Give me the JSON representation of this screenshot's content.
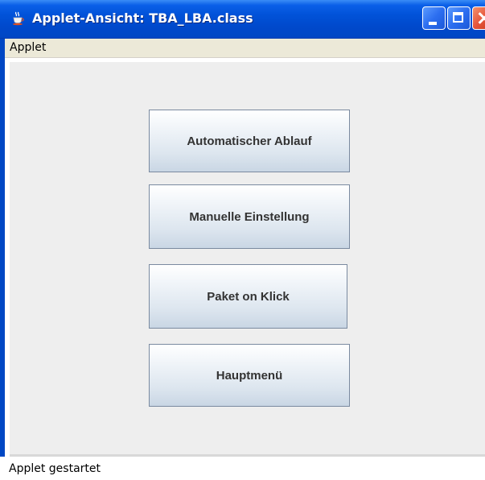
{
  "window": {
    "title": "Applet-Ansicht: TBA_LBA.class"
  },
  "menubar": {
    "items": [
      {
        "label": "Applet"
      }
    ]
  },
  "buttons": [
    {
      "label": "Automatischer Ablauf"
    },
    {
      "label": "Manuelle Einstellung"
    },
    {
      "label": "Paket on Klick"
    },
    {
      "label": "Hauptmenü"
    }
  ],
  "status": {
    "text": "Applet gestartet"
  },
  "colors": {
    "titlebar": "#0047c4",
    "client_background": "#eeeeee",
    "menubar_background": "#ece9d8"
  },
  "icons": {
    "window_icon": "java-coffee-cup-icon",
    "minimize": "minimize-icon",
    "maximize": "maximize-icon",
    "close": "close-icon"
  }
}
